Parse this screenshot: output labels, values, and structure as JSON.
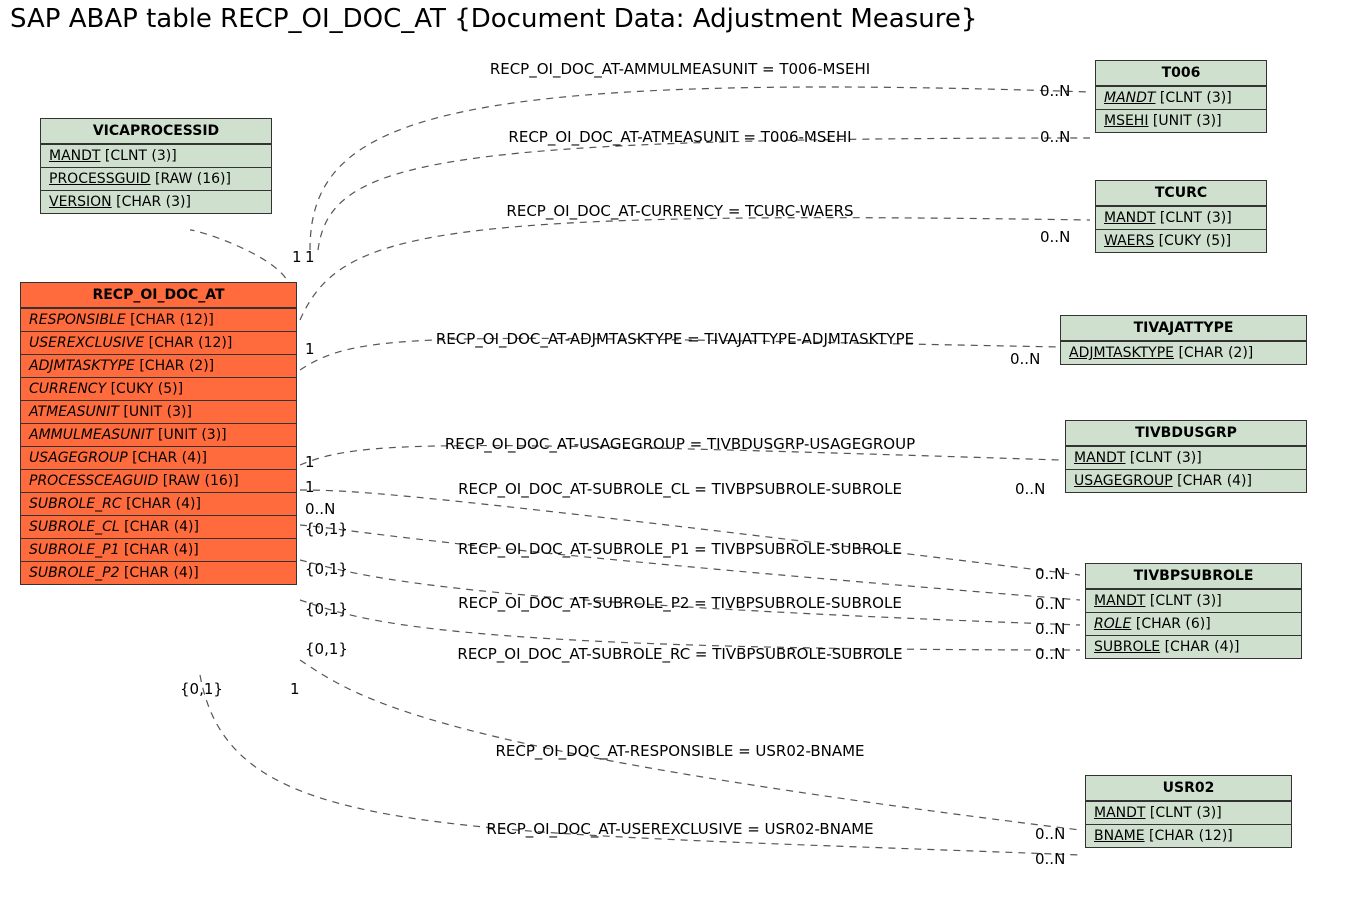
{
  "title": "SAP ABAP table RECP_OI_DOC_AT {Document Data: Adjustment Measure}",
  "tables": {
    "vicaprocessid": {
      "name": "VICAPROCESSID",
      "rows": [
        {
          "field": "MANDT",
          "type": "[CLNT (3)]",
          "u": true,
          "i": false
        },
        {
          "field": "PROCESSGUID",
          "type": "[RAW (16)]",
          "u": true,
          "i": false
        },
        {
          "field": "VERSION",
          "type": "[CHAR (3)]",
          "u": true,
          "i": false
        }
      ]
    },
    "recp": {
      "name": "RECP_OI_DOC_AT",
      "rows": [
        {
          "field": "RESPONSIBLE",
          "type": "[CHAR (12)]",
          "u": false,
          "i": true
        },
        {
          "field": "USEREXCLUSIVE",
          "type": "[CHAR (12)]",
          "u": false,
          "i": true
        },
        {
          "field": "ADJMTASKTYPE",
          "type": "[CHAR (2)]",
          "u": false,
          "i": true
        },
        {
          "field": "CURRENCY",
          "type": "[CUKY (5)]",
          "u": false,
          "i": true
        },
        {
          "field": "ATMEASUNIT",
          "type": "[UNIT (3)]",
          "u": false,
          "i": true
        },
        {
          "field": "AMMULMEASUNIT",
          "type": "[UNIT (3)]",
          "u": false,
          "i": true
        },
        {
          "field": "USAGEGROUP",
          "type": "[CHAR (4)]",
          "u": false,
          "i": true
        },
        {
          "field": "PROCESSCEAGUID",
          "type": "[RAW (16)]",
          "u": false,
          "i": true
        },
        {
          "field": "SUBROLE_RC",
          "type": "[CHAR (4)]",
          "u": false,
          "i": true
        },
        {
          "field": "SUBROLE_CL",
          "type": "[CHAR (4)]",
          "u": false,
          "i": true
        },
        {
          "field": "SUBROLE_P1",
          "type": "[CHAR (4)]",
          "u": false,
          "i": true
        },
        {
          "field": "SUBROLE_P2",
          "type": "[CHAR (4)]",
          "u": false,
          "i": true
        }
      ]
    },
    "t006": {
      "name": "T006",
      "rows": [
        {
          "field": "MANDT",
          "type": "[CLNT (3)]",
          "u": true,
          "i": true
        },
        {
          "field": "MSEHI",
          "type": "[UNIT (3)]",
          "u": true,
          "i": false
        }
      ]
    },
    "tcurc": {
      "name": "TCURC",
      "rows": [
        {
          "field": "MANDT",
          "type": "[CLNT (3)]",
          "u": true,
          "i": false
        },
        {
          "field": "WAERS",
          "type": "[CUKY (5)]",
          "u": true,
          "i": false
        }
      ]
    },
    "tivajattype": {
      "name": "TIVAJATTYPE",
      "rows": [
        {
          "field": "ADJMTASKTYPE",
          "type": "[CHAR (2)]",
          "u": true,
          "i": false
        }
      ]
    },
    "tivbdusgrp": {
      "name": "TIVBDUSGRP",
      "rows": [
        {
          "field": "MANDT",
          "type": "[CLNT (3)]",
          "u": true,
          "i": false
        },
        {
          "field": "USAGEGROUP",
          "type": "[CHAR (4)]",
          "u": true,
          "i": false
        }
      ]
    },
    "tivbpsubrole": {
      "name": "TIVBPSUBROLE",
      "rows": [
        {
          "field": "MANDT",
          "type": "[CLNT (3)]",
          "u": true,
          "i": false
        },
        {
          "field": "ROLE",
          "type": "[CHAR (6)]",
          "u": true,
          "i": true
        },
        {
          "field": "SUBROLE",
          "type": "[CHAR (4)]",
          "u": true,
          "i": false
        }
      ]
    },
    "usr02": {
      "name": "USR02",
      "rows": [
        {
          "field": "MANDT",
          "type": "[CLNT (3)]",
          "u": true,
          "i": false
        },
        {
          "field": "BNAME",
          "type": "[CHAR (12)]",
          "u": true,
          "i": false
        }
      ]
    }
  },
  "relations": [
    {
      "label": "RECP_OI_DOC_AT-AMMULMEASUNIT = T006-MSEHI",
      "card_r": "0..N"
    },
    {
      "label": "RECP_OI_DOC_AT-ATMEASUNIT = T006-MSEHI",
      "card_r": "0..N"
    },
    {
      "label": "RECP_OI_DOC_AT-CURRENCY = TCURC-WAERS",
      "card_r": "0..N"
    },
    {
      "label": "RECP_OI_DOC_AT-ADJMTASKTYPE = TIVAJATTYPE-ADJMTASKTYPE",
      "card_r": "0..N"
    },
    {
      "label": "RECP_OI_DOC_AT-USAGEGROUP = TIVBDUSGRP-USAGEGROUP",
      "card_r": "0..N"
    },
    {
      "label": "RECP_OI_DOC_AT-SUBROLE_CL = TIVBPSUBROLE-SUBROLE",
      "card_r": "0..N"
    },
    {
      "label": "RECP_OI_DOC_AT-SUBROLE_P1 = TIVBPSUBROLE-SUBROLE",
      "card_r": "0..N"
    },
    {
      "label": "RECP_OI_DOC_AT-SUBROLE_P2 = TIVBPSUBROLE-SUBROLE",
      "card_r": "0..N"
    },
    {
      "label": "RECP_OI_DOC_AT-SUBROLE_RC = TIVBPSUBROLE-SUBROLE",
      "card_r": "0..N"
    },
    {
      "label": "RECP_OI_DOC_AT-RESPONSIBLE = USR02-BNAME",
      "card_r": "0..N"
    },
    {
      "label": "RECP_OI_DOC_AT-USEREXCLUSIVE = USR02-BNAME",
      "card_r": "0..N"
    }
  ],
  "cards_left": [
    "1",
    "1",
    "1",
    "1",
    "1",
    "0..N",
    "{0,1}",
    "{0,1}",
    "{0,1}",
    "{0,1}",
    "{0,1}",
    "1"
  ]
}
